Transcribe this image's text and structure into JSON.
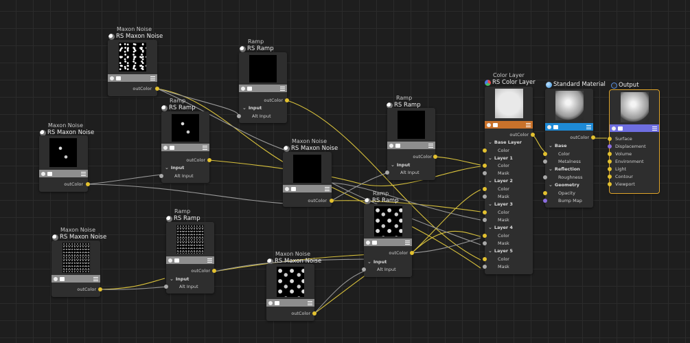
{
  "editor": {
    "nodes": {
      "noise1": {
        "sub": "Maxon Noise",
        "title": "RS Maxon Noise",
        "out": "outColor"
      },
      "noise2": {
        "sub": "Maxon Noise",
        "title": "RS Maxon Noise",
        "out": "outColor"
      },
      "noise3": {
        "sub": "Maxon Noise",
        "title": "RS Maxon Noise",
        "out": "outColor"
      },
      "noise4": {
        "sub": "Maxon Noise",
        "title": "RS Maxon Noise",
        "out": "outColor"
      },
      "noise5": {
        "sub": "Maxon Noise",
        "title": "RS Maxon Noise",
        "out": "outColor"
      },
      "ramp1": {
        "sub": "Ramp",
        "title": "RS Ramp",
        "out": "outColor",
        "group": "Input",
        "input": "Alt Input"
      },
      "ramp2": {
        "sub": "Ramp",
        "title": "RS Ramp",
        "out": "outColor",
        "group": "Input",
        "input": "Alt Input"
      },
      "ramp3": {
        "sub": "Ramp",
        "title": "RS Ramp",
        "out": "outColor",
        "group": "Input",
        "input": "Alt Input"
      },
      "ramp4": {
        "sub": "Ramp",
        "title": "RS Ramp",
        "out": "outColor",
        "group": "Input",
        "input": "Alt Input"
      },
      "ramp5": {
        "sub": "Ramp",
        "title": "RS Ramp",
        "out": "outColor",
        "group": "Input",
        "input": "Alt Input"
      },
      "colorlayer": {
        "sub": "Color Layer",
        "title": "RS Color Layer",
        "out": "outColor",
        "base": "Base Layer",
        "color": "Color",
        "mask": "Mask",
        "layers": [
          "Layer 1",
          "Layer 2",
          "Layer 3",
          "Layer 4",
          "Layer 5"
        ]
      },
      "standard": {
        "title": "Standard Material",
        "out": "outColor",
        "groups": {
          "base": "Base",
          "reflection": "Reflection",
          "geometry": "Geometry"
        },
        "ports": {
          "color": "Color",
          "metalness": "Metalness",
          "roughness": "Roughness",
          "opacity": "Opacity",
          "bump": "Bump Map"
        }
      },
      "output": {
        "title": "Output",
        "ports": [
          "Surface",
          "Displacement",
          "Volume",
          "Environment",
          "Light",
          "Contour",
          "Viewport"
        ]
      }
    }
  },
  "colors": {
    "background": "#1e1e1e",
    "wire_color": "#d9c23c",
    "wire_gray": "#9a9a9a",
    "color_layer_bar": "#c9722b",
    "standard_bar": "#1e8ad6",
    "output_bar": "#6e6ee0",
    "selection": "#e0a42a"
  }
}
